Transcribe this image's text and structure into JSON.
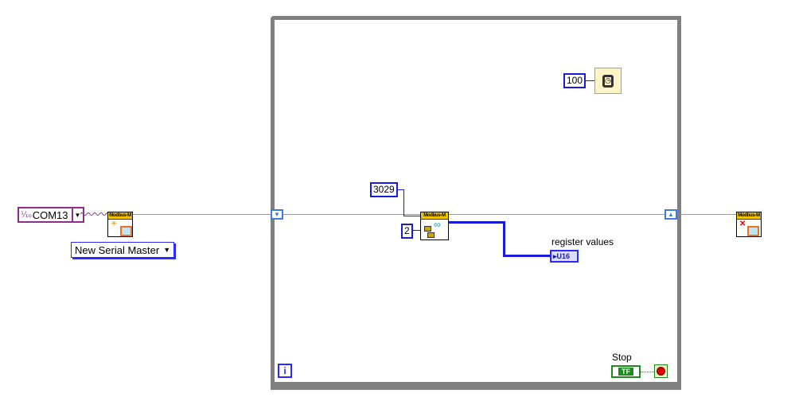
{
  "diagram": {
    "type": "LabVIEW block diagram",
    "open": {
      "resource_control": {
        "value": "COM13",
        "icon": "visa-resource-icon"
      },
      "mode_selector": {
        "value": "New Serial Master"
      },
      "vi": {
        "banner": "Modbus-M",
        "icon": "new-master-icon"
      }
    },
    "loop": {
      "wait_constant": "100",
      "wait_icon": "wait-ms-clock-icon",
      "address_constant": "3029",
      "count_constant": "2",
      "read_vi": {
        "banner": "Modbus-M",
        "icon": "read-holding-registers-icon"
      },
      "indicator": {
        "label": "register values",
        "type": "U16"
      },
      "stop": {
        "label": "Stop",
        "control": "TF"
      },
      "iteration_terminal": "i"
    },
    "close": {
      "vi": {
        "banner": "Modbus-M",
        "icon": "close-master-icon"
      }
    },
    "colors": {
      "loop_border": "#808080",
      "numeric_wire": "#1a1adb",
      "reference_wire": "#6aa6e8",
      "visa_wire": "#8b2f8b",
      "boolean": "#1f8b1f",
      "banner": "#f2c200"
    }
  }
}
